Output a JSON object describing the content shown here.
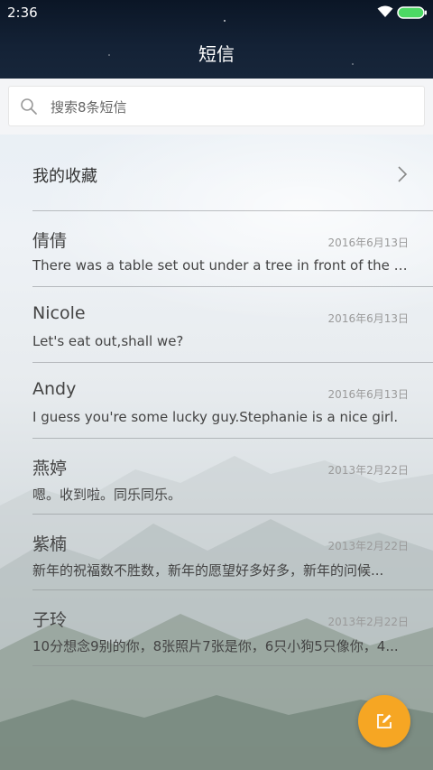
{
  "status_bar": {
    "time": "2:36"
  },
  "header": {
    "title": "短信"
  },
  "search": {
    "placeholder": "搜索8条短信"
  },
  "favorites": {
    "label": "我的收藏"
  },
  "conversations": [
    {
      "name": "倩倩",
      "date": "2016年6月13日",
      "preview": "There was a table set out under a tree in front of the ho..."
    },
    {
      "name": "Nicole",
      "date": "2016年6月13日",
      "preview": "Let's eat out,shall we?"
    },
    {
      "name": "Andy",
      "date": "2016年6月13日",
      "preview": "I guess you're some lucky guy.Stephanie is a nice girl."
    },
    {
      "name": "燕婷",
      "date": "2013年2月22日",
      "preview": "嗯。收到啦。同乐同乐。"
    },
    {
      "name": "紫楠",
      "date": "2013年2月22日",
      "preview": "新年的祝福数不胜数，新年的愿望好多好多，新年的问候..."
    },
    {
      "name": "子玲",
      "date": "2013年2月22日",
      "preview": "10分想念9别的你，8张照片7张是你，6只小狗5只像你，4..."
    }
  ],
  "icons": {
    "search": "search-icon",
    "chevron": "chevron-right-icon",
    "compose": "compose-icon",
    "wifi": "wifi-icon",
    "battery": "battery-icon"
  },
  "colors": {
    "header_bg": "#142236",
    "fab": "#f6a623",
    "battery": "#4cd964"
  }
}
